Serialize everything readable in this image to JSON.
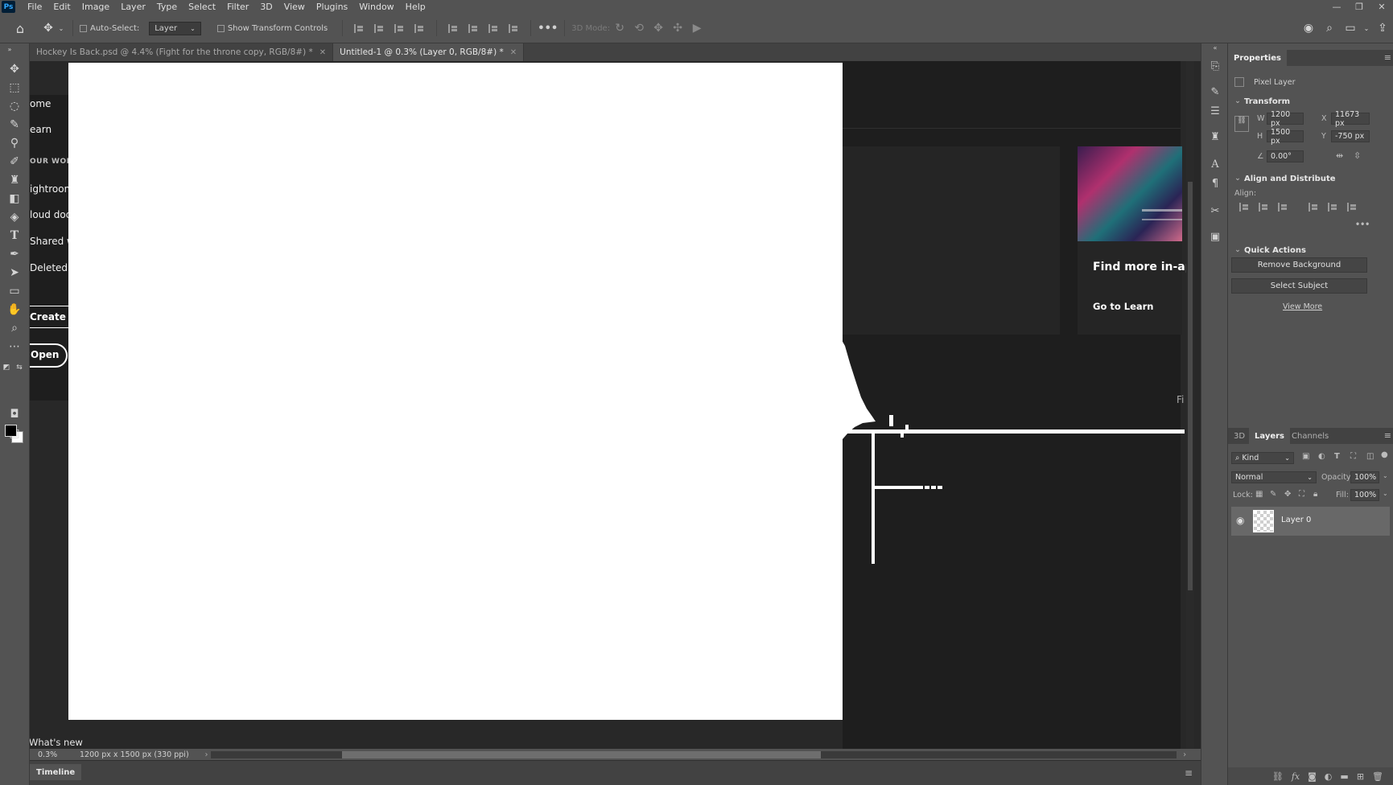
{
  "app": {
    "logo": "Ps"
  },
  "menu": [
    "File",
    "Edit",
    "Image",
    "Layer",
    "Type",
    "Select",
    "Filter",
    "3D",
    "View",
    "Plugins",
    "Window",
    "Help"
  ],
  "window_controls": {
    "minimize": "—",
    "restore": "❐",
    "close": "✕"
  },
  "options_bar": {
    "auto_select_label": "Auto-Select:",
    "auto_select_value": "Layer",
    "show_transform_label": "Show Transform Controls",
    "mode_3d_label": "3D Mode:",
    "more": "•••"
  },
  "tabs": [
    {
      "label": "Hockey Is Back.psd @ 4.4% (Fight for the throne copy, RGB/8#) *",
      "active": false
    },
    {
      "label": "Untitled-1 @ 0.3% (Layer 0, RGB/8#) *",
      "active": true
    }
  ],
  "home_screen": {
    "nav": [
      "ome",
      "earn",
      "OUR WORK",
      "ightroom",
      "loud docu",
      "Shared w",
      "Deleted"
    ],
    "create_new": "Create ne",
    "open": "Open",
    "promo_title": "Find more in-ap",
    "promo_link": "Go to Learn",
    "truncated_text": "Fi",
    "whats_new": "What's new"
  },
  "status_bar": {
    "zoom": "0.3%",
    "doc_info": "1200 px x 1500 px (330 ppi)"
  },
  "timeline": {
    "label": "Timeline"
  },
  "properties": {
    "tab": "Properties",
    "layer_type": "Pixel Layer",
    "transform": {
      "title": "Transform",
      "w_label": "W",
      "w": "1200 px",
      "h_label": "H",
      "h": "1500 px",
      "x_label": "X",
      "x": "11673 px",
      "y_label": "Y",
      "y": "-750 px",
      "angle": "0.00°"
    },
    "align": {
      "title": "Align and Distribute",
      "label": "Align:"
    },
    "quick_actions": {
      "title": "Quick Actions",
      "remove_bg": "Remove Background",
      "select_subject": "Select Subject",
      "view_more": "View More"
    }
  },
  "layers_panel": {
    "tabs": [
      "3D",
      "Layers",
      "Channels"
    ],
    "active_tab": "Layers",
    "kind": "Kind",
    "blend_mode": "Normal",
    "opacity_label": "Opacity:",
    "opacity": "100%",
    "lock_label": "Lock:",
    "fill_label": "Fill:",
    "fill": "100%",
    "layers": [
      {
        "name": "Layer 0",
        "visible": true
      }
    ]
  }
}
